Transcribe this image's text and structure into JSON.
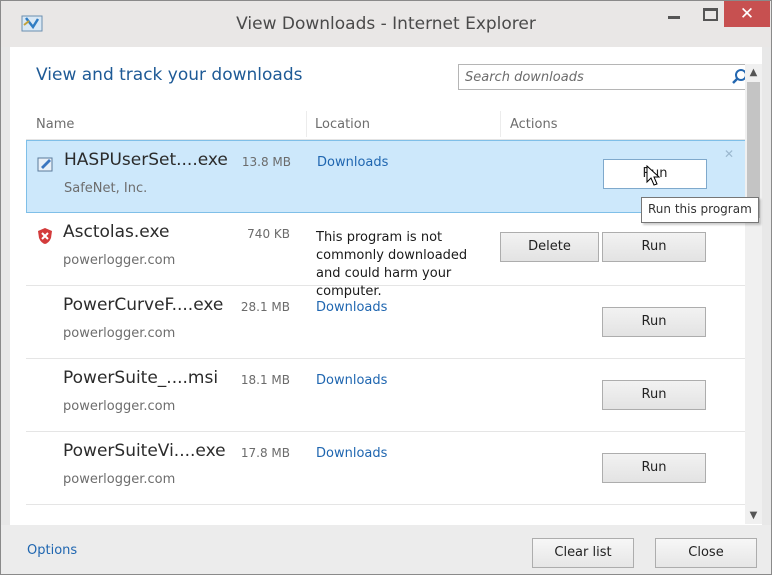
{
  "window": {
    "title": "View Downloads - Internet Explorer",
    "close_glyph": "✕"
  },
  "header": {
    "heading": "View and track your downloads",
    "search_placeholder": "Search downloads"
  },
  "columns": {
    "name": "Name",
    "location": "Location",
    "actions": "Actions"
  },
  "downloads": [
    {
      "name": "HASPUserSet....exe",
      "size": "13.8 MB",
      "source": "SafeNet, Inc.",
      "location": "Downloads",
      "run_label": "Run",
      "selected": true,
      "icon": "installer-icon"
    },
    {
      "name": "Asctolas.exe",
      "size": "740 KB",
      "source": "powerlogger.com",
      "warning": "This program is not commonly downloaded and could harm your computer.",
      "delete_label": "Delete",
      "run_label": "Run",
      "icon": "warning-shield-icon"
    },
    {
      "name": "PowerCurveF....exe",
      "size": "28.1 MB",
      "source": "powerlogger.com",
      "location": "Downloads",
      "run_label": "Run"
    },
    {
      "name": "PowerSuite_....msi",
      "size": "18.1 MB",
      "source": "powerlogger.com",
      "location": "Downloads",
      "run_label": "Run"
    },
    {
      "name": "PowerSuiteVi....exe",
      "size": "17.8 MB",
      "source": "powerlogger.com",
      "location": "Downloads",
      "run_label": "Run"
    }
  ],
  "tooltip": "Run this program",
  "dismiss_glyph": "✕",
  "footer": {
    "options": "Options",
    "clear_list": "Clear list",
    "close": "Close"
  },
  "colors": {
    "heading": "#1e5a96",
    "link": "#1f66b0",
    "selected_row": "#cde8fb",
    "close_button": "#c75050"
  }
}
